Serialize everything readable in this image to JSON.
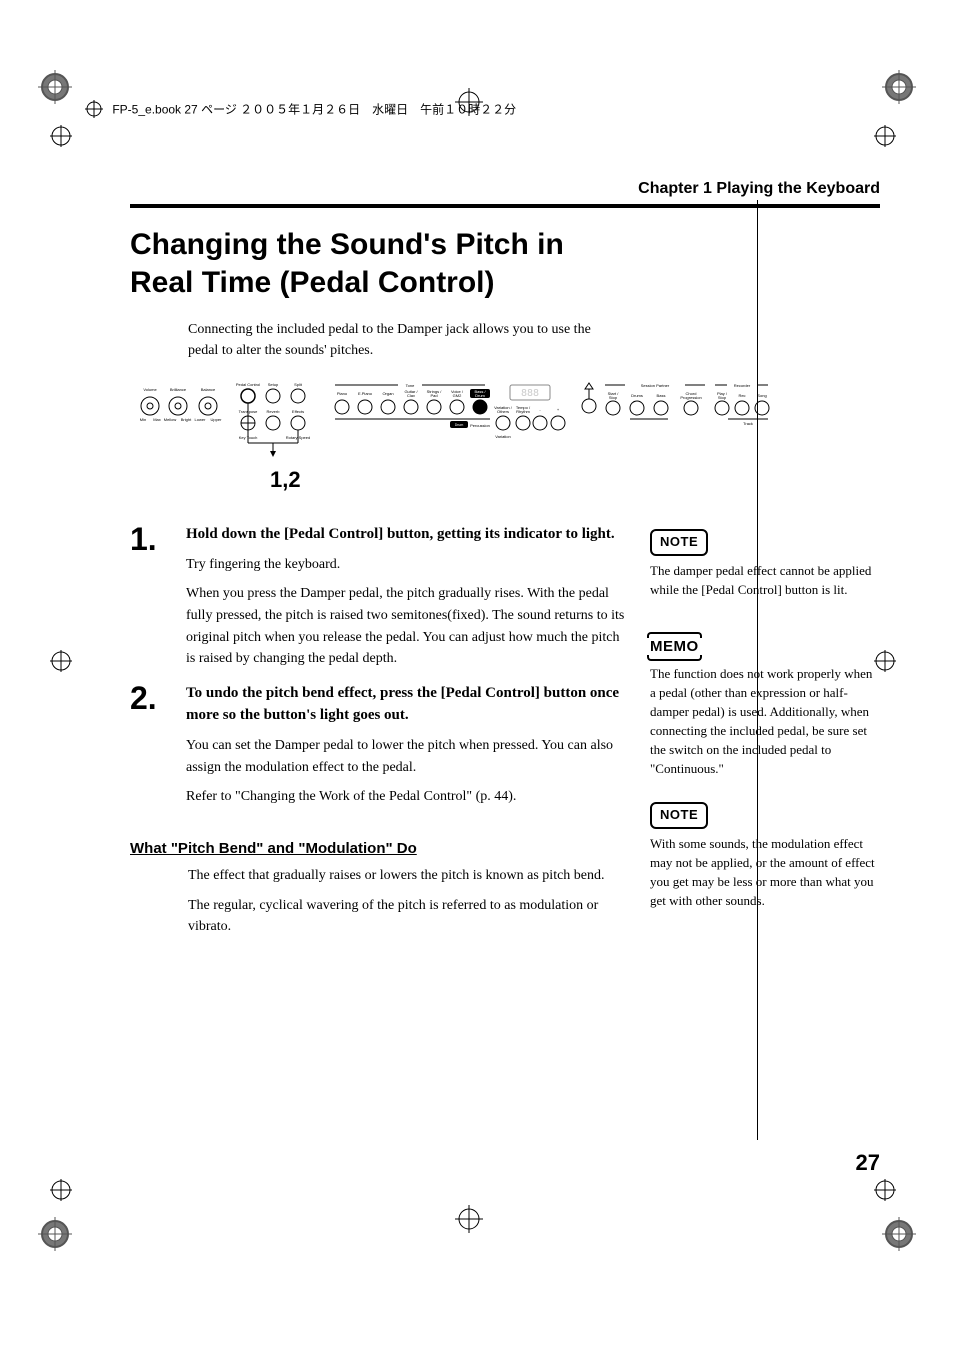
{
  "header": {
    "file_line": "FP-5_e.book 27 ページ ２００５年１月２６日　水曜日　午前１０時２２分"
  },
  "chapter": "Chapter 1 Playing the Keyboard",
  "title": "Changing the Sound's Pitch in Real Time (Pedal Control)",
  "intro": "Connecting the included pedal to the Damper jack allows you to use the pedal to alter the sounds' pitches.",
  "panel": {
    "labels": {
      "volume": "Volume",
      "brilliance": "Brilliance",
      "balance": "Balance",
      "pedal_control": "Pedal Control",
      "setup": "Setup",
      "split": "Split",
      "transpose": "Transpose",
      "reverb": "Reverb",
      "effects": "Effects",
      "key_touch": "Key Touch",
      "rotary_speed": "Rotary Speed",
      "tone": "Tone",
      "piano": "Piano",
      "epiano": "E.Piano",
      "organ": "Organ",
      "guitar_clav": "Guitar / Clav",
      "strings_pad": "Strings / Pad",
      "voice_gm2": "Voice / GM2",
      "bass_drum": "Bass / Drum",
      "variation_others": "Variation / Others",
      "tempo_rhythm": "Tempo / Rhythm",
      "variation": "Variation",
      "session_partner": "Session Partner",
      "start_stop": "Start / Stop",
      "drums": "Drums",
      "bass": "Bass",
      "chord_progression": "Chord Progression",
      "recorder": "Recorder",
      "play_stop": "Play / Stop",
      "rec": "Rec",
      "song": "Song",
      "track": "Track",
      "min": "Min",
      "max": "Max",
      "mellow": "Mellow",
      "bright": "Bright",
      "lower": "Lower",
      "upper": "Upper",
      "percussion": "Percussion"
    },
    "caption": "1,2"
  },
  "steps": [
    {
      "num": "1.",
      "head": "Hold down the [Pedal Control] button, getting its indicator to light.",
      "paras": [
        "Try fingering the keyboard.",
        "When you press the Damper pedal, the pitch gradually rises. With the pedal fully pressed, the pitch is raised two semitones(fixed). The sound returns to its original pitch when you release the pedal. You can adjust how much the pitch is raised by changing the pedal depth."
      ]
    },
    {
      "num": "2.",
      "head": "To undo the pitch bend effect, press the [Pedal Control] button once more so the button's light goes out.",
      "paras": [
        "You can set the Damper pedal to lower the pitch when pressed. You can also assign the modulation effect to the pedal.",
        "Refer to \"Changing the Work of the Pedal Control\" (p. 44)."
      ]
    }
  ],
  "subsection": {
    "head": "What \"Pitch Bend\" and \"Modulation\" Do",
    "paras": [
      "The effect that gradually raises or lowers the pitch is known as pitch bend.",
      "The regular, cyclical wavering of the pitch is referred to as modulation or vibrato."
    ]
  },
  "sidebar": {
    "note1_label": "NOTE",
    "note1_text": "The damper pedal effect cannot be applied while the [Pedal Control] button is lit.",
    "memo_label": "MEMO",
    "memo_text": "The function does not work properly when a pedal (other than expression or half-damper pedal) is used. Additionally, when connecting the included pedal, be sure set the switch on the included pedal to \"Continuous.\"",
    "note2_label": "NOTE",
    "note2_text": "With some sounds, the modulation effect may not be applied, or the amount of effect you get may be less or more than what you get with other sounds."
  },
  "page_number": "27"
}
